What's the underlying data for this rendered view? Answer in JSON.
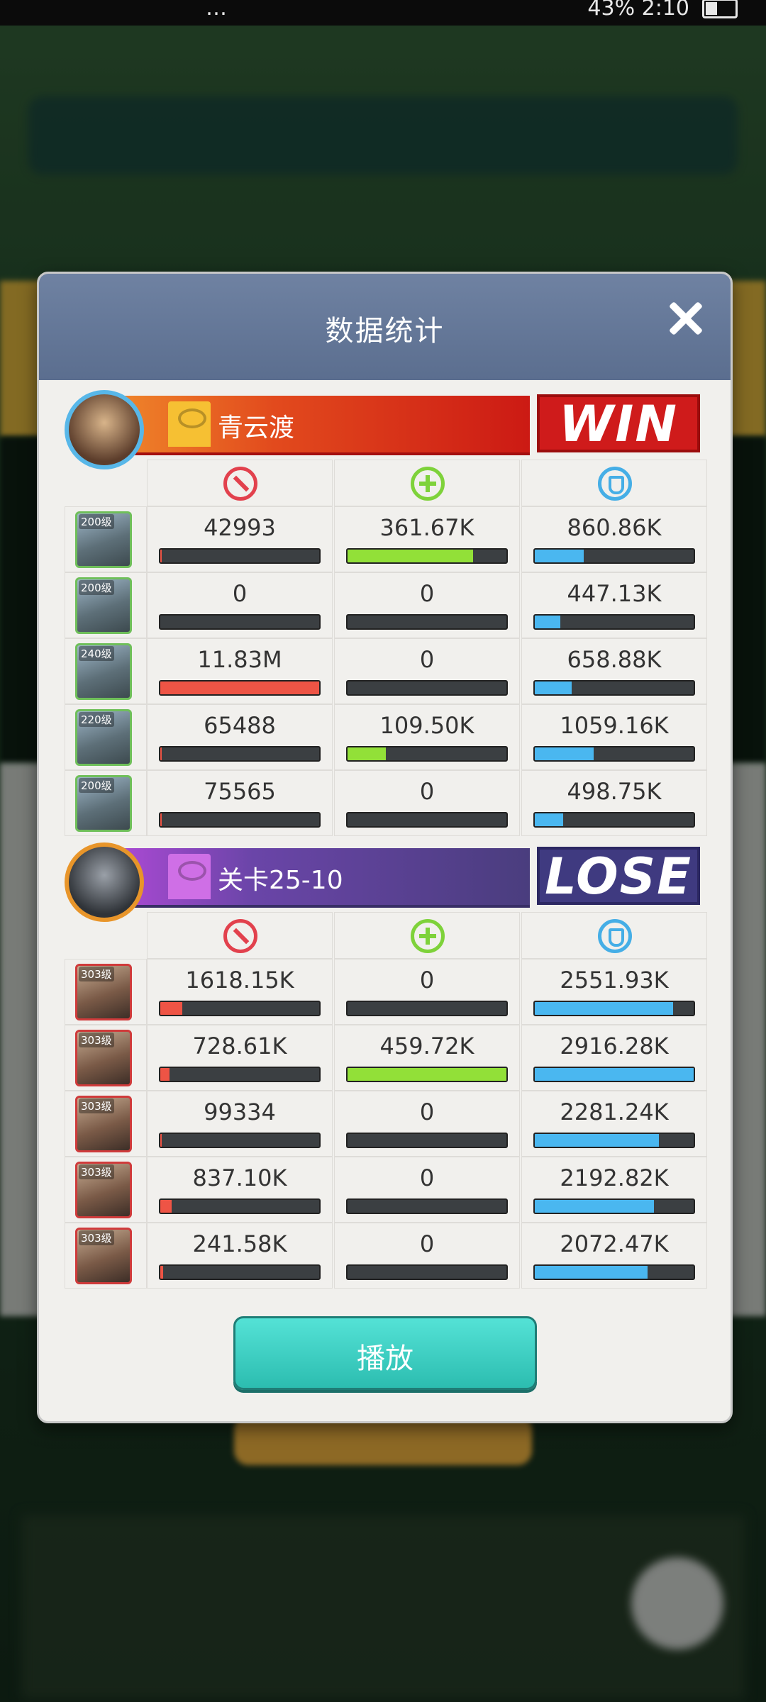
{
  "status_bar": {
    "left_text": "…",
    "right_text": "43% 2:10"
  },
  "dialog": {
    "title": "数据统计",
    "play_label": "播放"
  },
  "icons": {
    "damage": "damage-icon",
    "heal": "heal-icon",
    "shield": "shield-icon",
    "close": "close-icon"
  },
  "colors": {
    "damage_bar": "#ee5445",
    "heal_bar": "#92e038",
    "shield_bar": "#4ab7f0",
    "win": "#cf1b1b",
    "lose": "#3f3a80"
  },
  "teams": [
    {
      "name": "青云渡",
      "result": "WIN",
      "heroes": [
        {
          "level": "200级",
          "damage": {
            "label": "42993",
            "fill": 0.01
          },
          "heal": {
            "label": "361.67K",
            "fill": 0.79
          },
          "shield": {
            "label": "860.86K",
            "fill": 0.31
          }
        },
        {
          "level": "200级",
          "damage": {
            "label": "0",
            "fill": 0.0
          },
          "heal": {
            "label": "0",
            "fill": 0.0
          },
          "shield": {
            "label": "447.13K",
            "fill": 0.16
          }
        },
        {
          "level": "240级",
          "damage": {
            "label": "11.83M",
            "fill": 1.0
          },
          "heal": {
            "label": "0",
            "fill": 0.0
          },
          "shield": {
            "label": "658.88K",
            "fill": 0.23
          }
        },
        {
          "level": "220级",
          "damage": {
            "label": "65488",
            "fill": 0.01
          },
          "heal": {
            "label": "109.50K",
            "fill": 0.24
          },
          "shield": {
            "label": "1059.16K",
            "fill": 0.37
          }
        },
        {
          "level": "200级",
          "damage": {
            "label": "75565",
            "fill": 0.01
          },
          "heal": {
            "label": "0",
            "fill": 0.0
          },
          "shield": {
            "label": "498.75K",
            "fill": 0.18
          }
        }
      ]
    },
    {
      "name": "关卡25-10",
      "result": "LOSE",
      "heroes": [
        {
          "level": "303级",
          "damage": {
            "label": "1618.15K",
            "fill": 0.14
          },
          "heal": {
            "label": "0",
            "fill": 0.0
          },
          "shield": {
            "label": "2551.93K",
            "fill": 0.87
          }
        },
        {
          "level": "303级",
          "damage": {
            "label": "728.61K",
            "fill": 0.06
          },
          "heal": {
            "label": "459.72K",
            "fill": 1.0
          },
          "shield": {
            "label": "2916.28K",
            "fill": 1.0
          }
        },
        {
          "level": "303级",
          "damage": {
            "label": "99334",
            "fill": 0.01
          },
          "heal": {
            "label": "0",
            "fill": 0.0
          },
          "shield": {
            "label": "2281.24K",
            "fill": 0.78
          }
        },
        {
          "level": "303级",
          "damage": {
            "label": "837.10K",
            "fill": 0.07
          },
          "heal": {
            "label": "0",
            "fill": 0.0
          },
          "shield": {
            "label": "2192.82K",
            "fill": 0.75
          }
        },
        {
          "level": "303级",
          "damage": {
            "label": "241.58K",
            "fill": 0.02
          },
          "heal": {
            "label": "0",
            "fill": 0.0
          },
          "shield": {
            "label": "2072.47K",
            "fill": 0.71
          }
        }
      ]
    }
  ]
}
